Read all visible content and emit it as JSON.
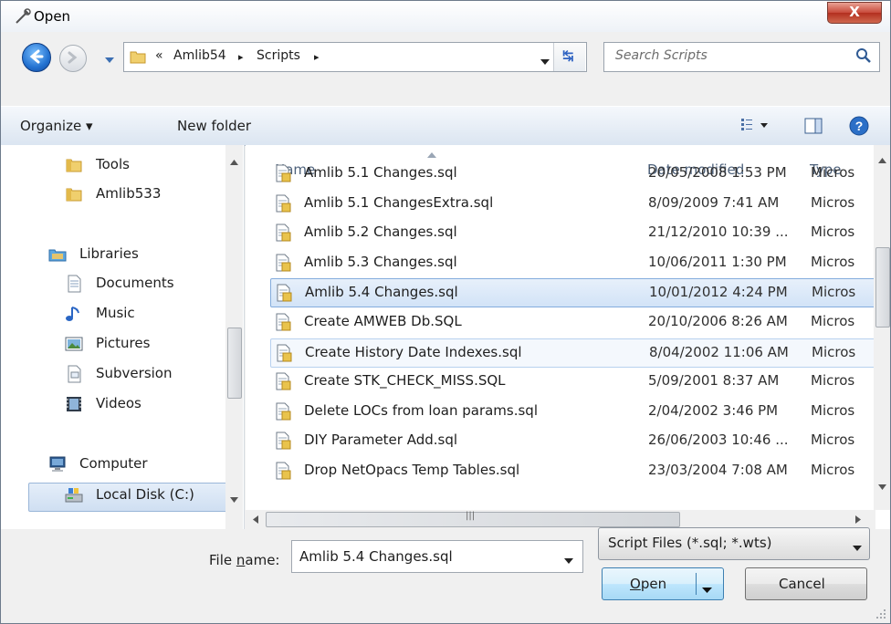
{
  "window": {
    "title": "Open",
    "close_label": "X"
  },
  "nav": {
    "breadcrumb": {
      "overflow": "«",
      "items": [
        "Amlib54",
        "Scripts"
      ],
      "separator": "▸"
    },
    "search_placeholder": "Search Scripts"
  },
  "toolbar": {
    "organize": "Organize ▾",
    "new_folder": "New folder"
  },
  "sidebar": {
    "items": [
      {
        "label": "Tools",
        "icon": "folder-icon"
      },
      {
        "label": "Amlib533",
        "icon": "folder-icon"
      },
      {
        "label": "Libraries",
        "icon": "libraries-icon"
      },
      {
        "label": "Documents",
        "icon": "documents-icon"
      },
      {
        "label": "Music",
        "icon": "music-icon"
      },
      {
        "label": "Pictures",
        "icon": "pictures-icon"
      },
      {
        "label": "Subversion",
        "icon": "subversion-icon"
      },
      {
        "label": "Videos",
        "icon": "videos-icon"
      },
      {
        "label": "Computer",
        "icon": "computer-icon"
      },
      {
        "label": "Local Disk (C:)",
        "icon": "disk-icon"
      }
    ]
  },
  "files": {
    "columns": [
      "Name",
      "Date modified",
      "Type"
    ],
    "rows": [
      {
        "name": "Amlib 5.1 Changes.sql",
        "date": "20/05/2008 1:53 PM",
        "type": "Micros"
      },
      {
        "name": "Amlib 5.1 ChangesExtra.sql",
        "date": "8/09/2009 7:41 AM",
        "type": "Micros"
      },
      {
        "name": "Amlib 5.2 Changes.sql",
        "date": "21/12/2010 10:39 ...",
        "type": "Micros"
      },
      {
        "name": "Amlib 5.3 Changes.sql",
        "date": "10/06/2011 1:30 PM",
        "type": "Micros"
      },
      {
        "name": "Amlib 5.4 Changes.sql",
        "date": "10/01/2012 4:24 PM",
        "type": "Micros"
      },
      {
        "name": "Create AMWEB Db.SQL",
        "date": "20/10/2006 8:26 AM",
        "type": "Micros"
      },
      {
        "name": "Create History Date Indexes.sql",
        "date": "8/04/2002 11:06 AM",
        "type": "Micros"
      },
      {
        "name": "Create STK_CHECK_MISS.SQL",
        "date": "5/09/2001 8:37 AM",
        "type": "Micros"
      },
      {
        "name": "Delete LOCs from loan params.sql",
        "date": "2/04/2002 3:46 PM",
        "type": "Micros"
      },
      {
        "name": "DIY Parameter Add.sql",
        "date": "26/06/2003 10:46 ...",
        "type": "Micros"
      },
      {
        "name": "Drop NetOpacs Temp Tables.sql",
        "date": "23/03/2004 7:08 AM",
        "type": "Micros"
      }
    ],
    "selected_index": 4,
    "hovered_index": 6
  },
  "footer": {
    "filename_label_pre": "File ",
    "filename_label_u": "n",
    "filename_label_post": "ame:",
    "filename_value": "Amlib 5.4 Changes.sql",
    "filetype_value": "Script Files (*.sql; *.wts)",
    "open_u": "O",
    "open_rest": "pen",
    "cancel": "Cancel"
  },
  "colors": {
    "selection": "#cde0f5",
    "close": "#c7493a",
    "link": "#2e62c2"
  }
}
